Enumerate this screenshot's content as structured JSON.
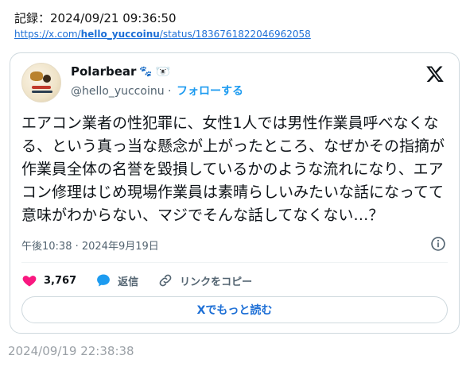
{
  "record": {
    "label": "記録：2024/09/21 09:36:50"
  },
  "source": {
    "url_prefix": "https://x.com/",
    "url_handle": "hello_yuccoinu",
    "url_suffix": "/status/1836761822046962058"
  },
  "tweet": {
    "display_name": "Polarbear",
    "name_emoji_paws": "🐾",
    "name_emoji_bear": "🐻‍❄️",
    "handle": "@hello_yuccoinu",
    "separator": "·",
    "follow_label": "フォローする",
    "text": "エアコン業者の性犯罪に、女性1人では男性作業員呼べなくなる、という真っ当な懸念が上がったところ、なぜかその指摘が作業員全体の名誉を毀損しているかのような流れになり、エアコン修理はじめ現場作業員は素晴らしいみたいな話になってて意味がわからない、マジでそんな話してなくない…？",
    "timestamp": "午後10:38 · 2024年9月19日",
    "likes": "3,767",
    "reply_label": "返信",
    "copy_link_label": "リンクをコピー",
    "read_more_label": "Xでもっと読む"
  },
  "footer": {
    "date": "2024/09/19 22:38:38"
  },
  "colors": {
    "accent": "#1d9bf0",
    "like": "#f91880",
    "muted": "#536471"
  },
  "icons": [
    "x-logo-icon",
    "info-icon",
    "heart-icon",
    "reply-bubble-icon",
    "link-icon"
  ]
}
